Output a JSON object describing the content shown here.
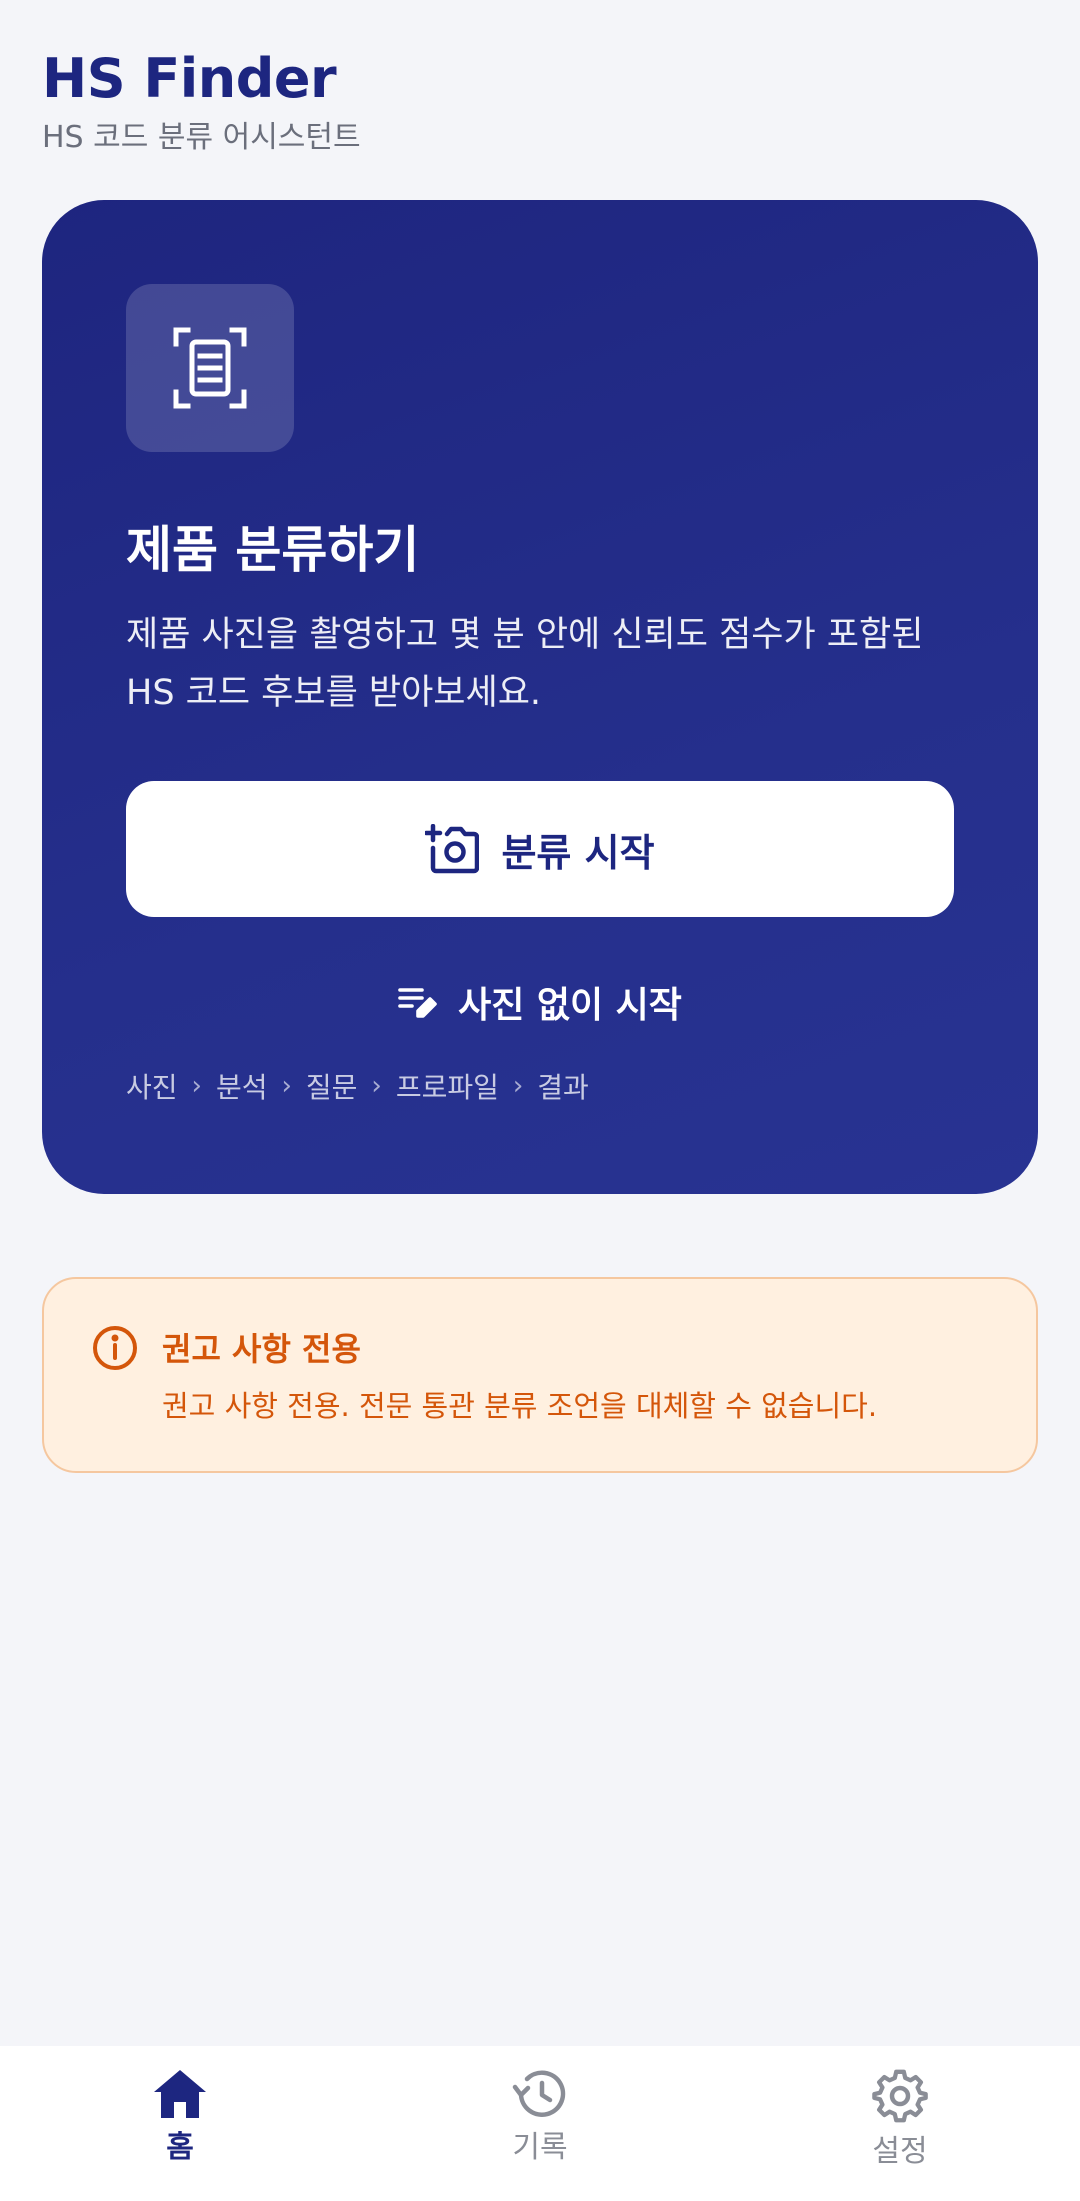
{
  "header": {
    "title": "HS Finder",
    "subtitle": "HS 코드 분류 어시스턴트"
  },
  "hero": {
    "icon": "document-scan-icon",
    "title": "제품 분류하기",
    "description": "제품 사진을 촬영하고 몇 분 안에 신뢰도 점수가 포함된 HS 코드 후보를 받아보세요.",
    "primary_button": {
      "label": "분류 시작",
      "icon": "add-camera-icon"
    },
    "secondary_button": {
      "label": "사진 없이 시작",
      "icon": "edit-note-icon"
    },
    "steps": [
      "사진",
      "분석",
      "질문",
      "프로파일",
      "결과"
    ]
  },
  "notice": {
    "icon": "info-icon",
    "title": "권고 사항 전용",
    "body": "권고 사항 전용. 전문 통관 분류 조언을 대체할 수 없습니다."
  },
  "bottom_nav": {
    "items": [
      {
        "label": "홈",
        "icon": "home-icon",
        "active": true
      },
      {
        "label": "기록",
        "icon": "history-icon",
        "active": false
      },
      {
        "label": "설정",
        "icon": "gear-icon",
        "active": false
      }
    ]
  },
  "colors": {
    "primary": "#1d2680",
    "background": "#f4f5f9",
    "warning": "#d4560a",
    "warning_bg": "#fff0e0"
  }
}
